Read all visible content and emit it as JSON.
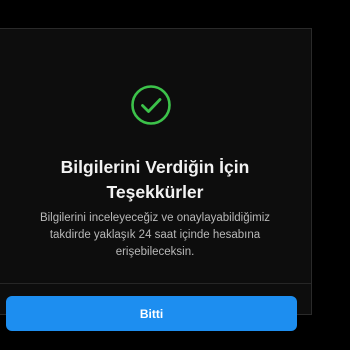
{
  "dialog": {
    "icon": "check-circle-icon",
    "icon_color": "#3cc24a",
    "title_line1": "Bilgilerini Verdiğin İçin",
    "title_line2": "Teşekkürler",
    "description_line1": "Bilgilerini inceleyeceğiz ve onaylayabildiğimiz",
    "description_line2": "takdirde yaklaşık 24 saat içinde hesabına",
    "description_line3": "erişebileceksin.",
    "done_label": "Bitti",
    "button_color": "#1d8ef0"
  }
}
